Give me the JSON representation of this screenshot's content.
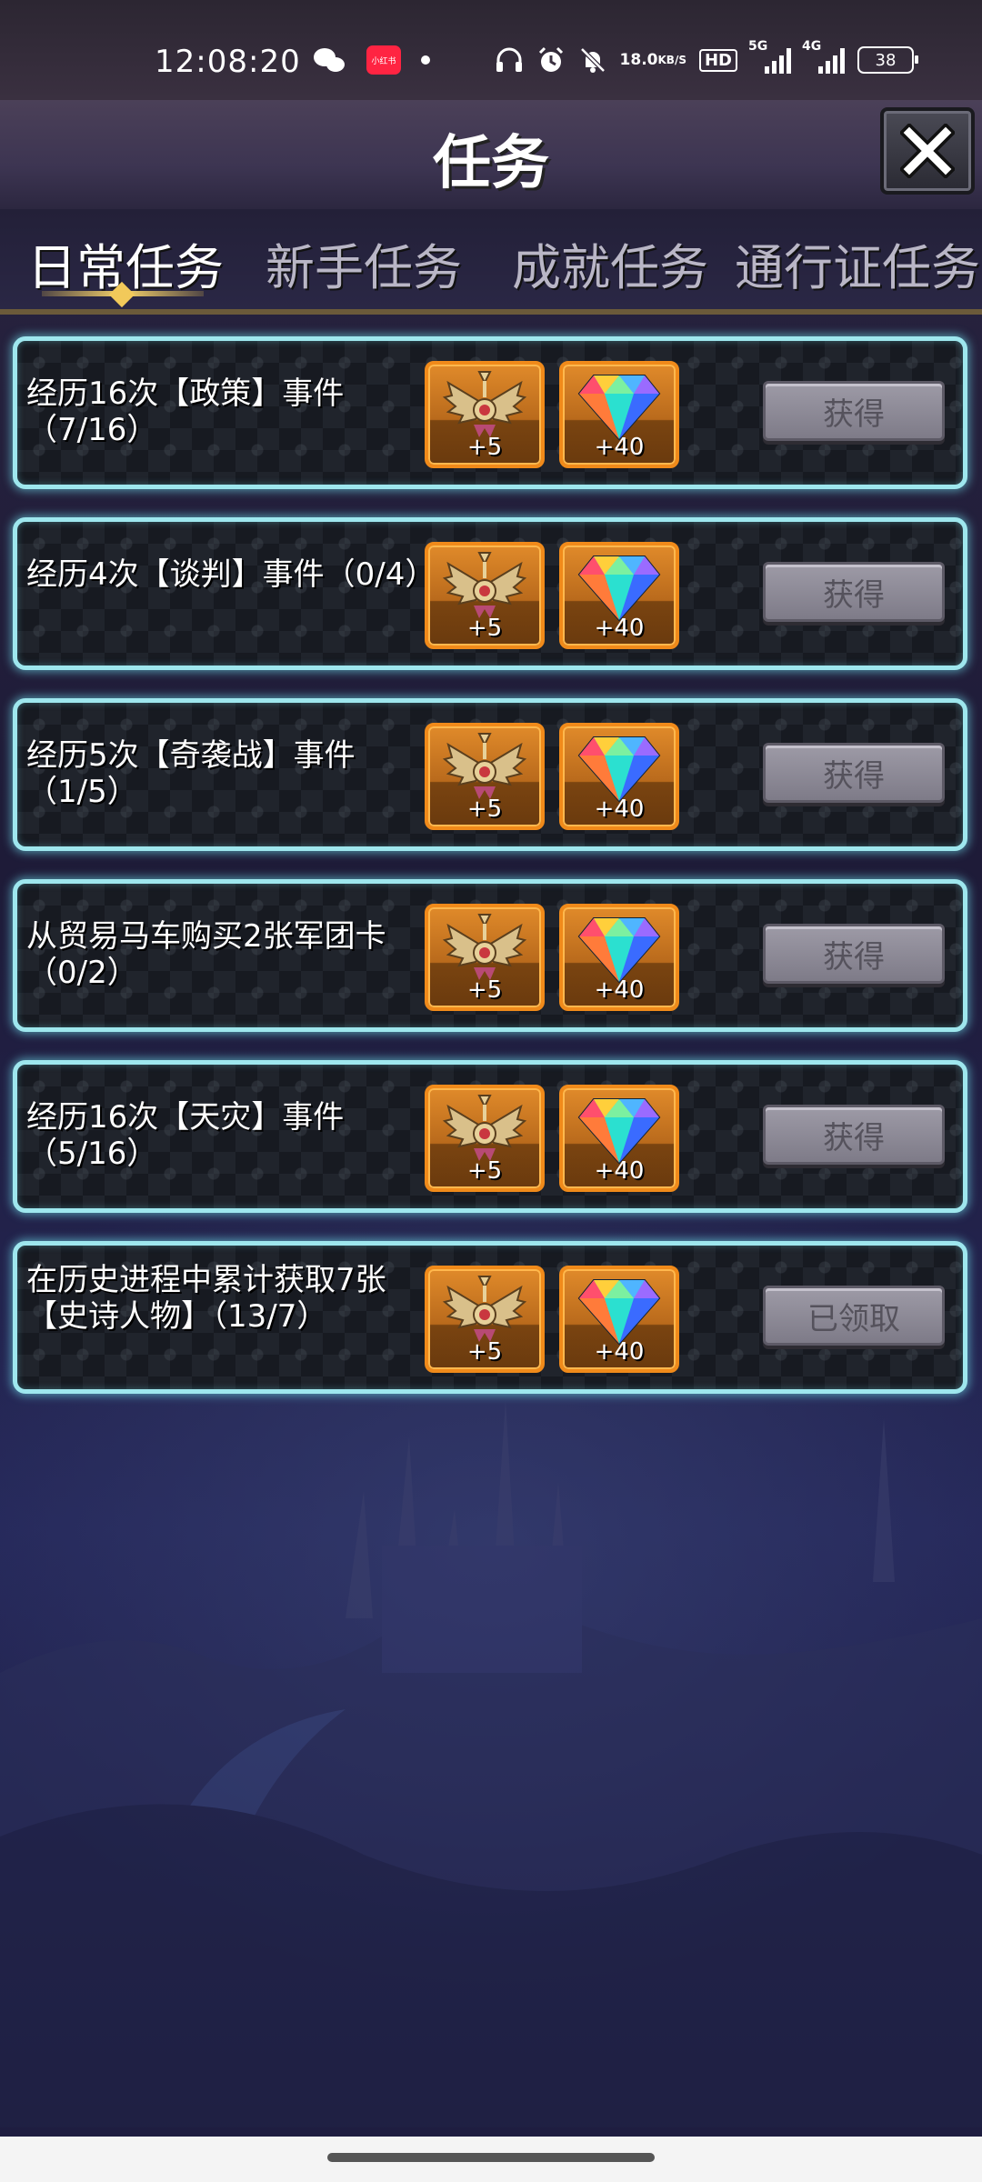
{
  "status_bar": {
    "time": "12:08:20",
    "notification_app": "小红书",
    "net_speed_value": "18.0",
    "net_speed_unit": "KB/S",
    "hd_label": "HD",
    "net_5g": "5G",
    "net_4g": "4G",
    "battery_level": "38"
  },
  "header": {
    "title": "任务"
  },
  "tabs": [
    {
      "label": "日常任务",
      "active": true
    },
    {
      "label": "新手任务",
      "active": false
    },
    {
      "label": "成就任务",
      "active": false
    },
    {
      "label": "通行证任务",
      "active": false
    }
  ],
  "tasks": [
    {
      "desc": "经历16次【政策】事件（7/16）",
      "medal_amount": "+5",
      "gem_amount": "+40",
      "button": "获得"
    },
    {
      "desc": "经历4次【谈判】事件（0/4）",
      "medal_amount": "+5",
      "gem_amount": "+40",
      "button": "获得"
    },
    {
      "desc": "经历5次【奇袭战】事件（1/5）",
      "medal_amount": "+5",
      "gem_amount": "+40",
      "button": "获得"
    },
    {
      "desc": "从贸易马车购买2张军团卡（0/2）",
      "medal_amount": "+5",
      "gem_amount": "+40",
      "button": "获得"
    },
    {
      "desc": "经历16次【天灾】事件（5/16）",
      "medal_amount": "+5",
      "gem_amount": "+40",
      "button": "获得"
    },
    {
      "desc": "在历史进程中累计获取7张【史诗人物】（13/7）",
      "medal_amount": "+5",
      "gem_amount": "+40",
      "button": "已领取"
    }
  ]
}
